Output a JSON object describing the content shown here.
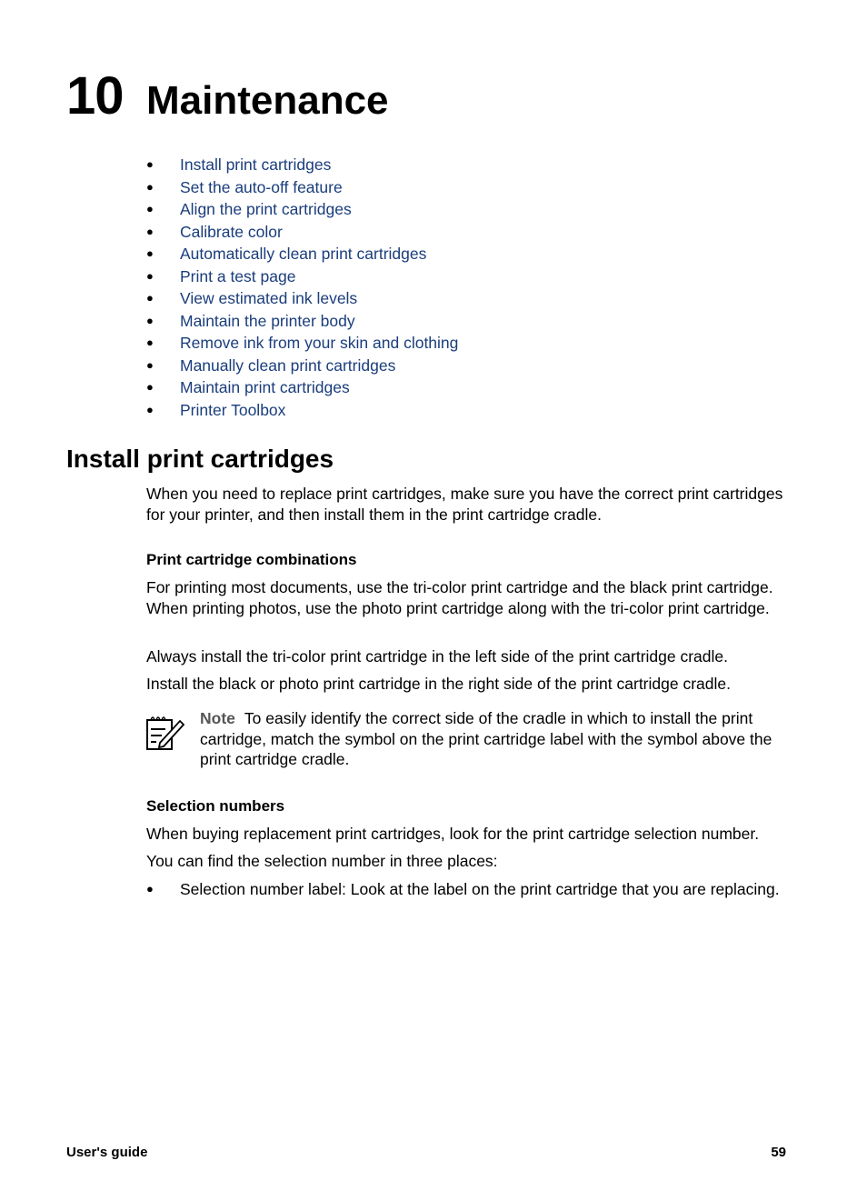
{
  "chapter": {
    "number": "10",
    "title": "Maintenance"
  },
  "toc": [
    "Install print cartridges",
    "Set the auto-off feature",
    "Align the print cartridges",
    "Calibrate color",
    "Automatically clean print cartridges",
    "Print a test page",
    "View estimated ink levels",
    "Maintain the printer body",
    "Remove ink from your skin and clothing",
    "Manually clean print cartridges",
    "Maintain print cartridges",
    "Printer Toolbox"
  ],
  "section": {
    "title": "Install print cartridges",
    "intro": "When you need to replace print cartridges, make sure you have the correct print cartridges for your printer, and then install them in the print cartridge cradle.",
    "sub1": {
      "title": "Print cartridge combinations",
      "p1": "For printing most documents, use the tri-color print cartridge and the black print cartridge. When printing photos, use the photo print cartridge along with the tri-color print cartridge.",
      "p2": "Always install the tri-color print cartridge in the left side of the print cartridge cradle.",
      "p3": "Install the black or photo print cartridge in the right side of the print cartridge cradle.",
      "note_label": "Note",
      "note_text": "To easily identify the correct side of the cradle in which to install the print cartridge, match the symbol on the print cartridge label with the symbol above the print cartridge cradle."
    },
    "sub2": {
      "title": "Selection numbers",
      "p1": "When buying replacement print cartridges, look for the print cartridge selection number.",
      "p2": "You can find the selection number in three places:",
      "bullet1": "Selection number label: Look at the label on the print cartridge that you are replacing."
    }
  },
  "footer": {
    "left": "User's guide",
    "page": "59"
  }
}
